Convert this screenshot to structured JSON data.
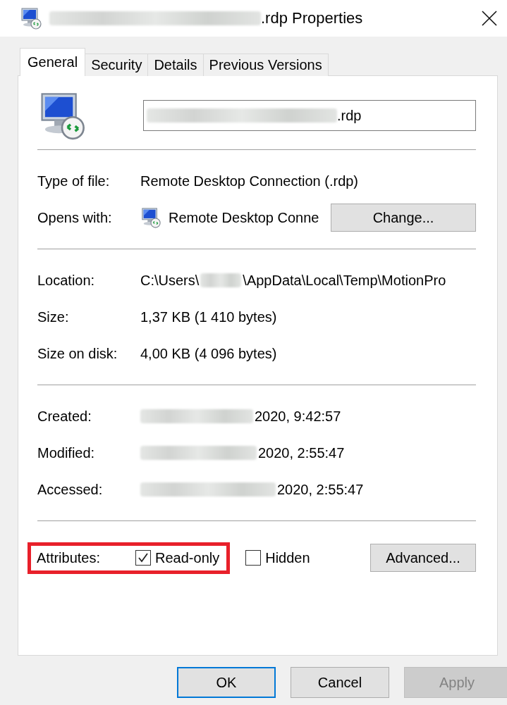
{
  "window": {
    "title": [
      {
        "kind": "redacted"
      },
      {
        "kind": "text",
        "text": ".rdp Properties"
      }
    ]
  },
  "tabs": [
    {
      "label": "General",
      "selected": true
    },
    {
      "label": "Security",
      "selected": false
    },
    {
      "label": "Details",
      "selected": false
    },
    {
      "label": "Previous Versions",
      "selected": false
    }
  ],
  "file": {
    "name": [
      {
        "kind": "redacted"
      },
      {
        "kind": "text",
        "text": ".rdp"
      }
    ]
  },
  "sections": [
    [
      {
        "kind": "text",
        "label": "Type of file:",
        "value": [
          {
            "kind": "text",
            "text": "Remote Desktop Connection (.rdp)"
          }
        ]
      },
      {
        "kind": "app",
        "label": "Opens with:",
        "value": [
          {
            "kind": "text",
            "text": "Remote Desktop Conne"
          }
        ],
        "button": "Change..."
      }
    ],
    [
      {
        "kind": "text",
        "label": "Location:",
        "value": [
          {
            "kind": "text",
            "text": "C:\\Users\\"
          },
          {
            "kind": "redacted"
          },
          {
            "kind": "text",
            "text": "\\AppData\\Local\\Temp\\MotionPro"
          }
        ]
      },
      {
        "kind": "text",
        "label": "Size:",
        "value": [
          {
            "kind": "text",
            "text": "1,37 KB (1 410 bytes)"
          }
        ]
      },
      {
        "kind": "text",
        "label": "Size on disk:",
        "value": [
          {
            "kind": "text",
            "text": "4,00 KB (4 096 bytes)"
          }
        ]
      }
    ],
    [
      {
        "kind": "text",
        "label": "Created:",
        "value": [
          {
            "kind": "redacted"
          },
          {
            "kind": "text",
            "text": "2020, 9:42:57"
          }
        ]
      },
      {
        "kind": "text",
        "label": "Modified:",
        "value": [
          {
            "kind": "redacted"
          },
          {
            "kind": "text",
            "text": "2020, 2:55:47"
          }
        ]
      },
      {
        "kind": "text",
        "label": "Accessed:",
        "value": [
          {
            "kind": "redacted"
          },
          {
            "kind": "text",
            "text": "2020, 2:55:47"
          }
        ]
      }
    ]
  ],
  "attributes": {
    "label": "Attributes:",
    "highlighted": true,
    "checkboxes": [
      {
        "label": "Read-only",
        "checked": true
      },
      {
        "label": "Hidden",
        "checked": false
      }
    ],
    "button": "Advanced..."
  },
  "buttons": [
    {
      "label": "OK",
      "kind": "default",
      "disabled": false
    },
    {
      "label": "Cancel",
      "kind": "normal",
      "disabled": false
    },
    {
      "label": "Apply",
      "kind": "normal",
      "disabled": true
    }
  ]
}
